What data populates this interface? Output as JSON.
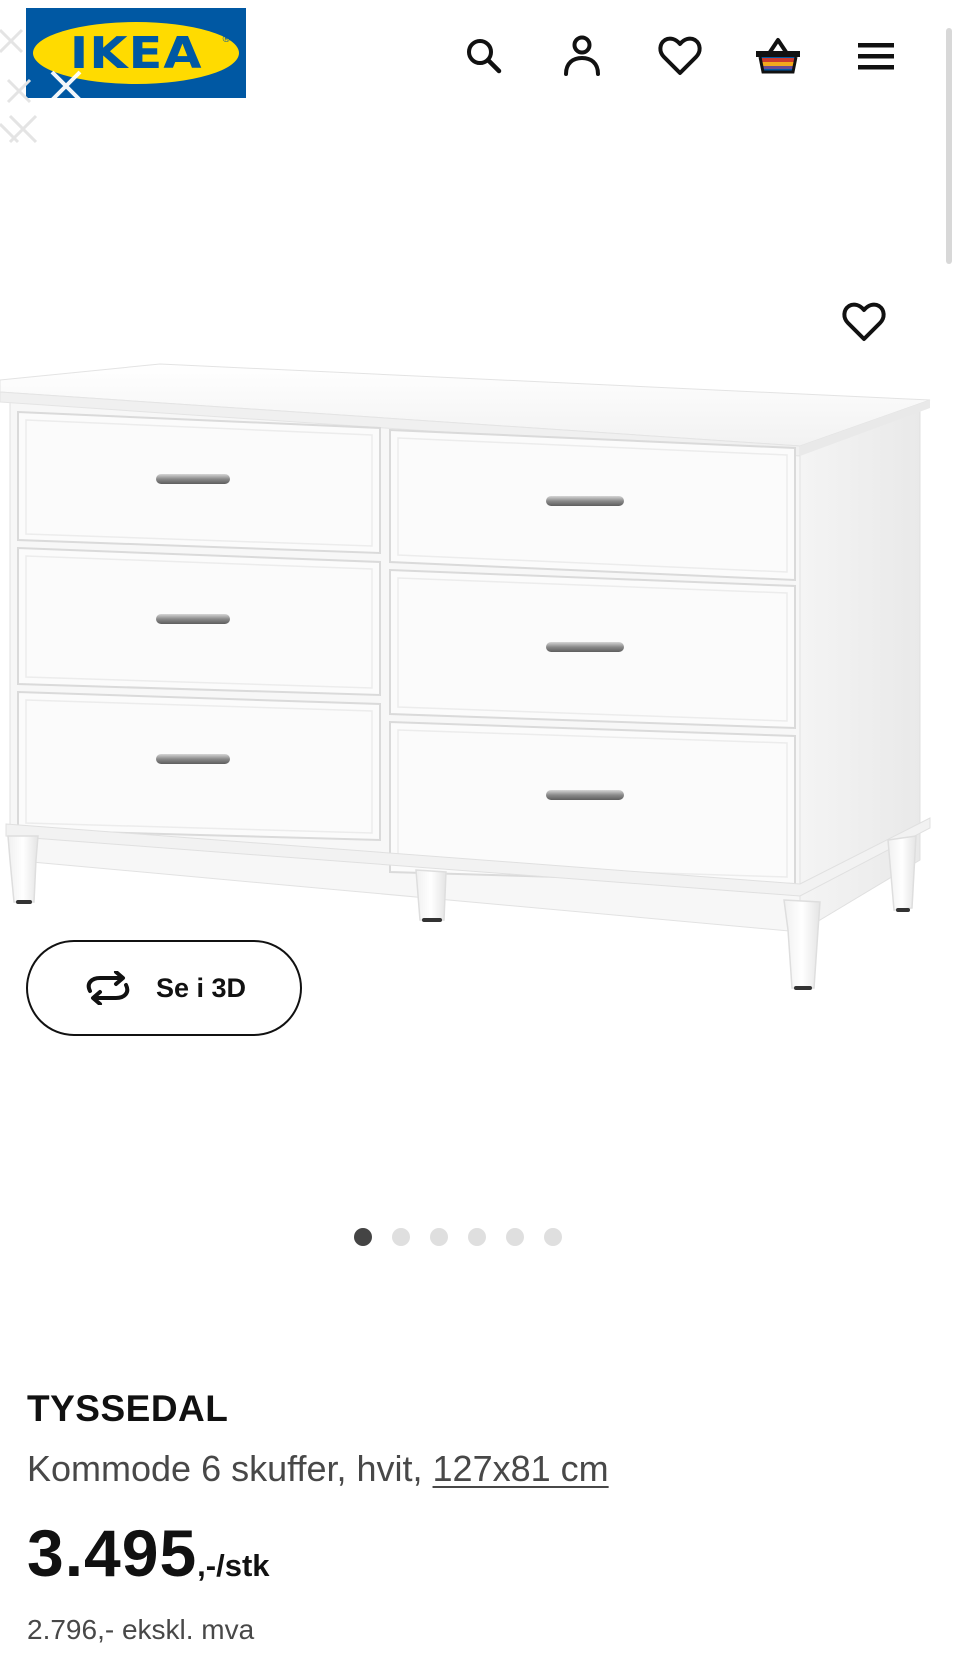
{
  "header": {
    "logo_text": "IKEA",
    "logo_reg": "®",
    "icons": [
      "search-icon",
      "account-icon",
      "wishlist-icon",
      "cart-icon",
      "menu-icon"
    ]
  },
  "gallery": {
    "image_subject": "dresser-image",
    "view3d_label": "Se i 3D",
    "slide_count": 6,
    "active_slide": 0
  },
  "product": {
    "name": "TYSSEDAL",
    "description": "Kommode 6 skuffer, hvit, ",
    "size": "127x81 cm",
    "price_main": "3.495",
    "price_suffix": ",-/stk",
    "price_excl_vat": "2.796,- ekskl. mva"
  },
  "colors": {
    "brand_blue": "#0058a3",
    "brand_yellow": "#ffdb00",
    "text_primary": "#111111",
    "text_secondary": "#484848"
  }
}
